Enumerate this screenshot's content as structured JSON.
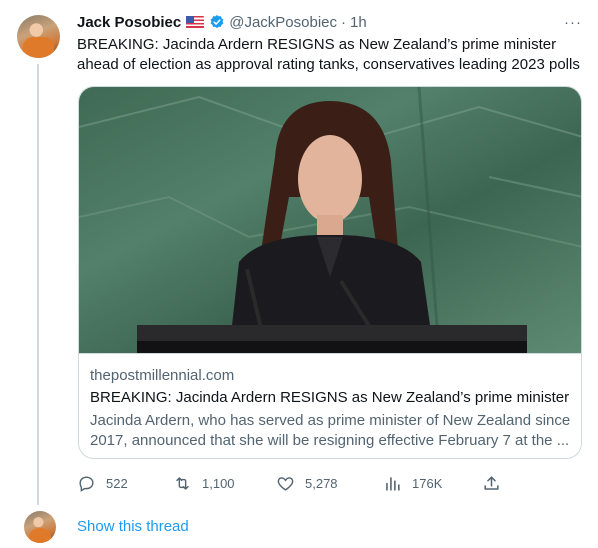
{
  "tweet": {
    "author_name": "Jack Posobiec",
    "author_handle": "@JackPosobiec",
    "separator": "·",
    "time": "1h",
    "text": "BREAKING: Jacinda Ardern RESIGNS as New Zealand’s prime minister ahead of election as approval rating tanks, conservatives leading 2023 polls",
    "more_label": "···",
    "flag_icon": "us-flag-icon",
    "verified_icon": "verified-badge-icon"
  },
  "card": {
    "domain": "thepostmillennial.com",
    "title": "BREAKING: Jacinda Ardern RESIGNS as New Zealand’s prime minister",
    "description": "Jacinda Ardern, who has served as prime minister of New Zealand since 2017, announced that she will be resigning effective February 7 at the ..."
  },
  "actions": {
    "replies": "522",
    "retweets": "1,100",
    "likes": "5,278",
    "views": "176K"
  },
  "thread": {
    "show_label": "Show this thread"
  },
  "colors": {
    "accent": "#1d9bf0",
    "secondary_text": "#536471",
    "border": "#cfd9de"
  }
}
